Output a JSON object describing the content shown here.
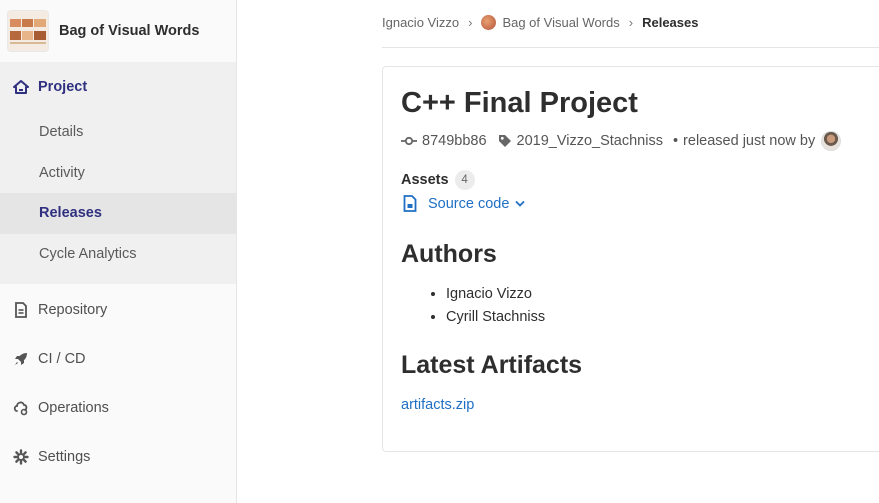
{
  "sidebar": {
    "project_name": "Bag of Visual Words",
    "project_icon": "project-avatar",
    "section": {
      "label": "Project",
      "icon": "home-icon"
    },
    "sub_items": [
      {
        "label": "Details"
      },
      {
        "label": "Activity"
      },
      {
        "label": "Releases"
      },
      {
        "label": "Cycle Analytics"
      }
    ],
    "items": [
      {
        "label": "Repository",
        "icon": "doc-icon"
      },
      {
        "label": "CI / CD",
        "icon": "rocket-icon"
      },
      {
        "label": "Operations",
        "icon": "cloud-gear-icon"
      },
      {
        "label": "Settings",
        "icon": "gear-icon"
      }
    ],
    "active_color": "#303081"
  },
  "breadcrumb": {
    "user": "Ignacio Vizzo",
    "project": "Bag of Visual Words",
    "current": "Releases"
  },
  "release": {
    "title": "C++ Final Project",
    "commit": "8749bb86",
    "tag": "2019_Vizzo_Stachniss",
    "released_text": "released just now by",
    "assets_label": "Assets",
    "assets_count": "4",
    "source_code_label": "Source code",
    "authors_heading": "Authors",
    "authors": [
      "Ignacio Vizzo",
      "Cyrill Stachniss"
    ],
    "artifacts_heading": "Latest Artifacts",
    "artifact_link": "artifacts.zip",
    "link_color": "#1f6fc4"
  }
}
